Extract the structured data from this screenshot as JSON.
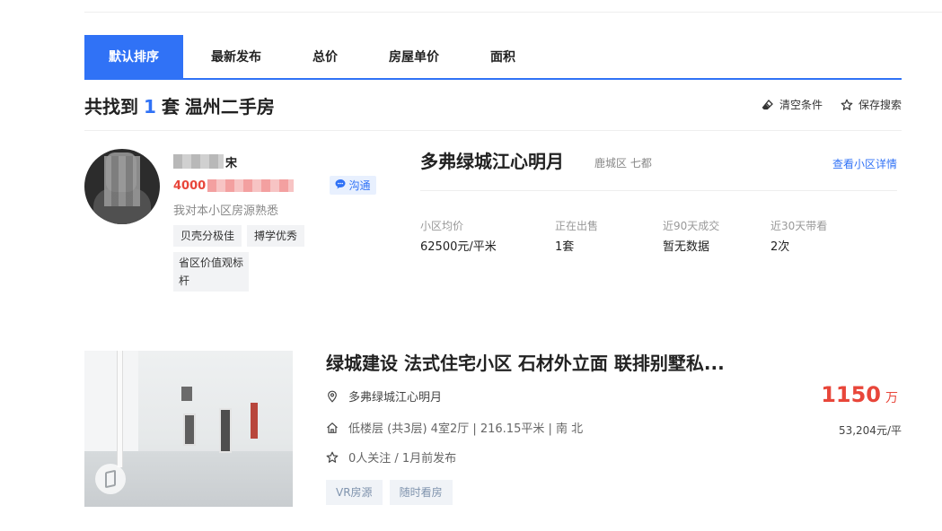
{
  "sort_tabs": [
    {
      "label": "默认排序"
    },
    {
      "label": "最新发布"
    },
    {
      "label": "总价"
    },
    {
      "label": "房屋单价"
    },
    {
      "label": "面积"
    }
  ],
  "result": {
    "prefix": "共找到",
    "count": "1",
    "measure": "套",
    "city_label": "温州二手房"
  },
  "actions": {
    "clear": "清空条件",
    "save": "保存搜索"
  },
  "agent": {
    "name_visible": "宋",
    "phone_visible": "4000",
    "chat": "沟通",
    "desc": "我对本小区房源熟悉",
    "tags": [
      "贝壳分极佳",
      "搏学优秀",
      "省区价值观标杆"
    ]
  },
  "community": {
    "name": "多弗绿城江心明月",
    "area": "鹿城区 七都",
    "detail_link": "查看小区详情",
    "stats": [
      {
        "label": "小区均价",
        "value": "62500元/平米"
      },
      {
        "label": "正在出售",
        "value": "1套"
      },
      {
        "label": "近90天成交",
        "value": "暂无数据"
      },
      {
        "label": "近30天带看",
        "value": "2次"
      }
    ]
  },
  "listing": {
    "title": "绿城建设 法式住宅小区 石材外立面 联排别墅私...",
    "community": "多弗绿城江心明月",
    "house_info": "低楼层 (共3层) 4室2厅 | 216.15平米 | 南 北",
    "follow_info": "0人关注 / 1月前发布",
    "total_price": "1150",
    "total_unit": "万",
    "unit_price": "53,204元/平",
    "tags": [
      "VR房源",
      "随时看房"
    ]
  },
  "colors": {
    "accent": "#3072f6",
    "price_red": "#e8463a"
  }
}
